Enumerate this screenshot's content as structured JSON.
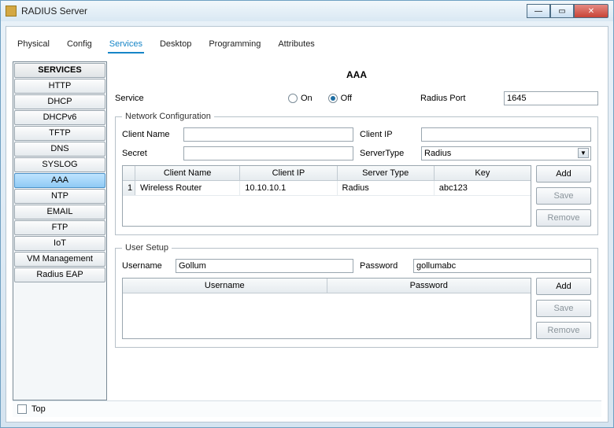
{
  "window": {
    "title": "RADIUS Server"
  },
  "tabs": [
    "Physical",
    "Config",
    "Services",
    "Desktop",
    "Programming",
    "Attributes"
  ],
  "active_tab": "Services",
  "sidebar": {
    "header": "SERVICES",
    "items": [
      "HTTP",
      "DHCP",
      "DHCPv6",
      "TFTP",
      "DNS",
      "SYSLOG",
      "AAA",
      "NTP",
      "EMAIL",
      "FTP",
      "IoT",
      "VM Management",
      "Radius EAP"
    ],
    "selected": "AAA"
  },
  "page_title": "AAA",
  "service_row": {
    "label": "Service",
    "on_label": "On",
    "off_label": "Off",
    "value": "Off",
    "port_label": "Radius Port",
    "port_value": "1645"
  },
  "netcfg": {
    "legend": "Network Configuration",
    "client_name_label": "Client Name",
    "client_name": "",
    "client_ip_label": "Client IP",
    "client_ip": "",
    "secret_label": "Secret",
    "secret": "",
    "server_type_label": "ServerType",
    "server_type": "Radius",
    "columns": [
      "Client Name",
      "Client IP",
      "Server Type",
      "Key"
    ],
    "rows": [
      {
        "idx": "1",
        "client_name": "Wireless Router",
        "client_ip": "10.10.10.1",
        "server_type": "Radius",
        "key": "abc123"
      }
    ],
    "buttons": {
      "add": "Add",
      "save": "Save",
      "remove": "Remove"
    }
  },
  "usersetup": {
    "legend": "User Setup",
    "username_label": "Username",
    "username": "Gollum",
    "password_label": "Password",
    "password": "gollumabc",
    "columns": [
      "Username",
      "Password"
    ],
    "buttons": {
      "add": "Add",
      "save": "Save",
      "remove": "Remove"
    }
  },
  "footer": {
    "top_label": "Top"
  }
}
